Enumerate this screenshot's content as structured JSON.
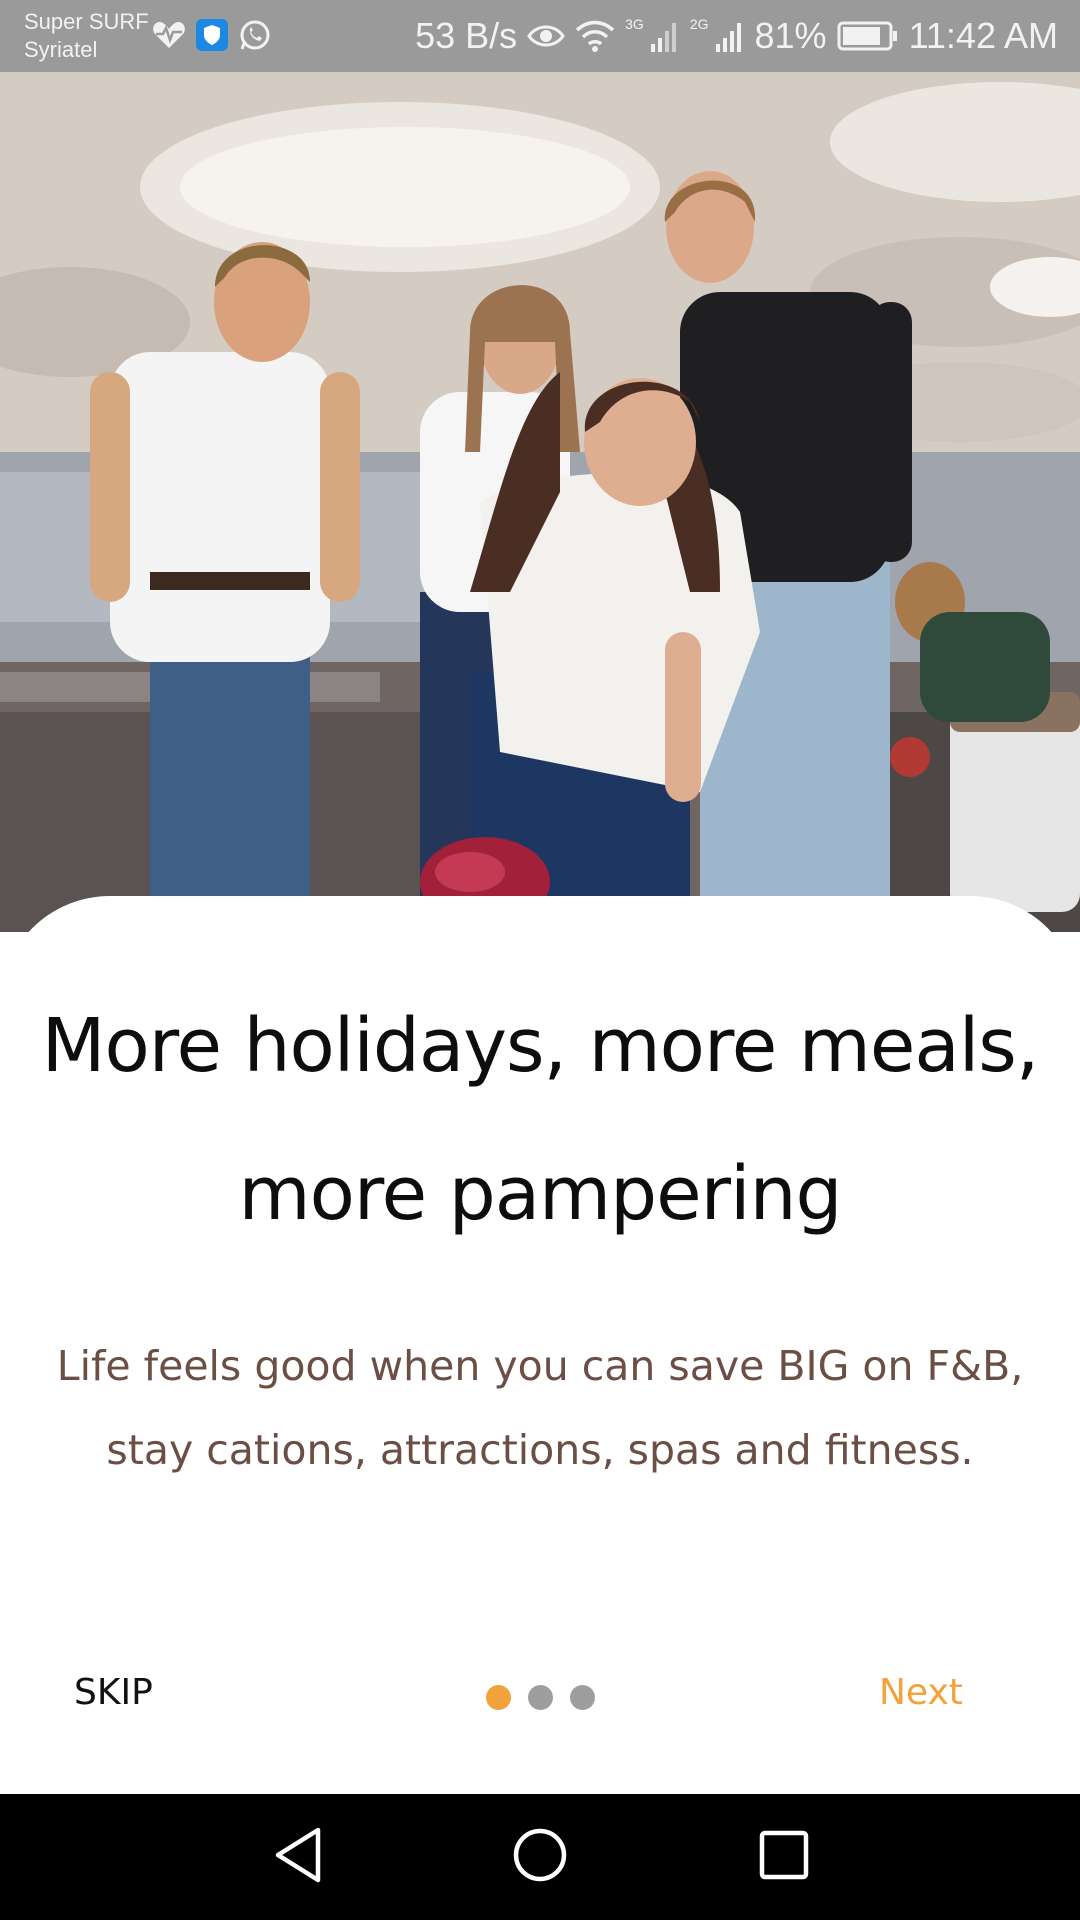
{
  "status_bar": {
    "carrier_line1": "Super SURF",
    "carrier_line2": "Syriatel",
    "speed": "53 B/s",
    "network1": "3G",
    "network2": "2G",
    "battery": "81%",
    "time": "11:42 AM",
    "icons": [
      "heart-pulse-icon",
      "shield-icon",
      "whatsapp-icon",
      "eye-icon",
      "wifi-icon",
      "signal-icon",
      "battery-icon"
    ]
  },
  "hero": {
    "image": "friends-bowling-photo"
  },
  "onboarding": {
    "headline": "More holidays, more meals, more pampering",
    "description": "Life feels good when you can save BIG on F&B, stay cations, attractions, spas and fitness.",
    "skip_label": "SKIP",
    "next_label": "Next",
    "page_count": 3,
    "current_page": 1
  },
  "colors": {
    "accent": "#f2a23a",
    "subtext": "#6b4f45",
    "dot_inactive": "#9e9e9e"
  },
  "nav_bar": {
    "icons": [
      "back-icon",
      "home-icon",
      "recents-icon"
    ]
  }
}
